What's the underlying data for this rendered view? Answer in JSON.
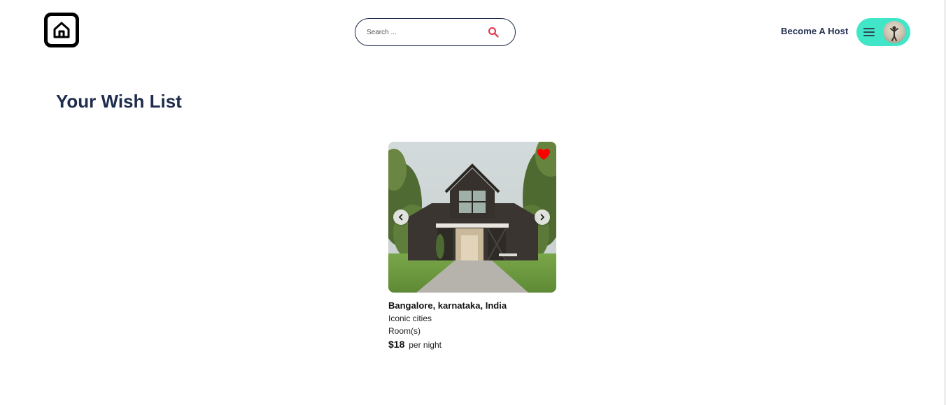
{
  "header": {
    "search": {
      "placeholder": "Search ..."
    },
    "become_host_label": "Become A Host"
  },
  "main": {
    "title": "Your Wish List",
    "listing": {
      "location": "Bangalore, karnataka, India",
      "category": "Iconic cities",
      "type": "Room(s)",
      "price": "$18",
      "price_suffix": "per night",
      "favorited": true
    }
  },
  "colors": {
    "brand_text": "#1f2d4d",
    "user_menu_bg": "#40e6c8",
    "search_icon": "#e0314b",
    "heart": "#ff0000"
  },
  "icons": {
    "logo": "home-icon",
    "search": "search-icon",
    "menu": "hamburger-icon",
    "prev": "chevron-left-icon",
    "next": "chevron-right-icon",
    "favorite": "heart-icon"
  }
}
